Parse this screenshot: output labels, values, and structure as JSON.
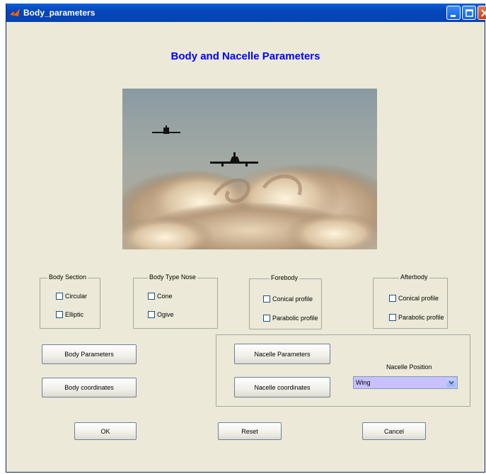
{
  "window": {
    "title": "Body_parameters"
  },
  "heading": "Body and Nacelle Parameters",
  "body_section": {
    "legend": "Body Section",
    "options": [
      "Circular",
      "Elliptic"
    ]
  },
  "body_type_nose": {
    "legend": "Body Type Nose",
    "options": [
      "Cone",
      "Ogive"
    ]
  },
  "forebody": {
    "legend": "Forebody",
    "options": [
      "Conical profile",
      "Parabolic profile"
    ]
  },
  "afterbody": {
    "legend": "Afterbody",
    "options": [
      "Conical profile",
      "Parabolic profile"
    ]
  },
  "buttons": {
    "body_parameters": "Body Parameters",
    "body_coordinates": "Body coordinates",
    "nacelle_parameters": "Nacelle Parameters",
    "nacelle_coordinates": "Nacelle coordinates",
    "ok": "OK",
    "reset": "Reset",
    "cancel": "Cancel"
  },
  "nacelle_position": {
    "label": "Nacelle Position",
    "selected": "Wing"
  },
  "colors": {
    "heading": "#0000ff",
    "titlebar": "#0546b9",
    "select_bg": "#c8c0ff",
    "background": "#ece9d8"
  },
  "icons": [
    "matlab-icon",
    "minimize-icon",
    "maximize-icon",
    "close-icon",
    "chevron-down-icon"
  ]
}
